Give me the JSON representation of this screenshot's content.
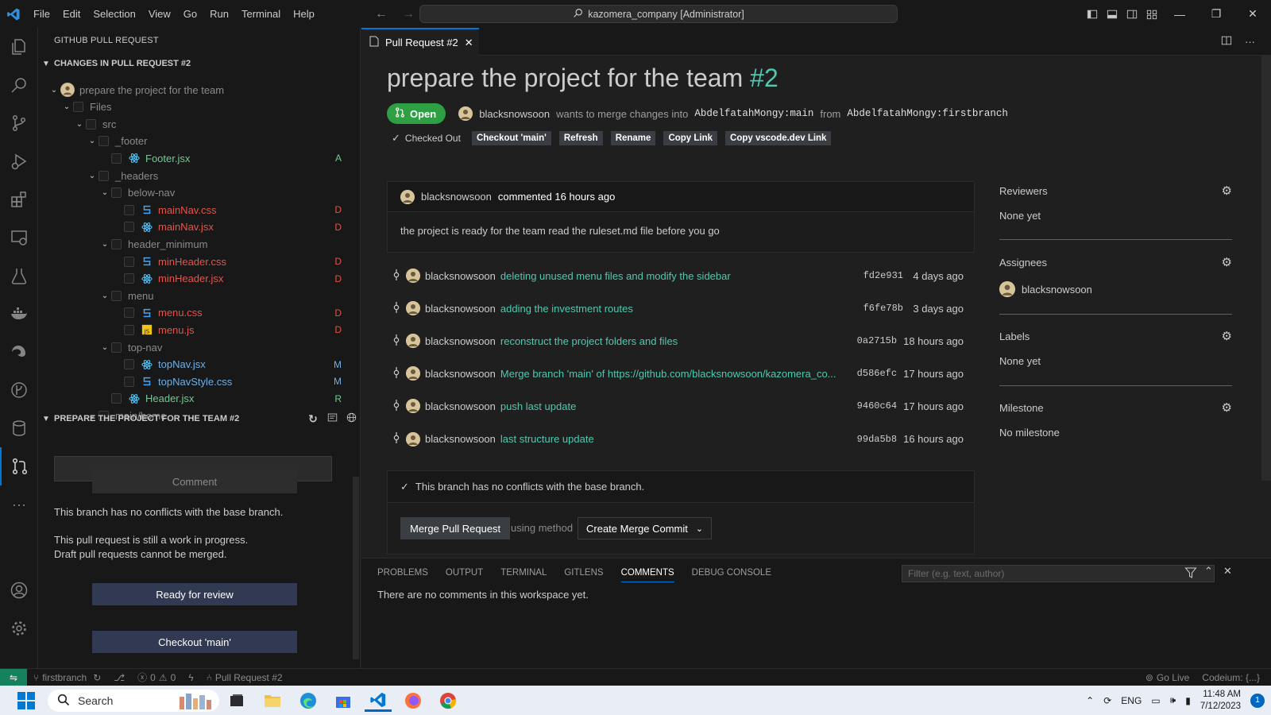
{
  "titlebar": {
    "menu": [
      "File",
      "Edit",
      "Selection",
      "View",
      "Go",
      "Run",
      "Terminal",
      "Help"
    ],
    "command_center": "kazomera_company [Administrator]"
  },
  "sidebar": {
    "title": "GITHUB PULL REQUEST",
    "changes_header": "CHANGES IN PULL REQUEST #2",
    "tree": [
      {
        "label": "prepare the project for the team",
        "type": "pr",
        "depth": 0,
        "decoration": ""
      },
      {
        "label": "Files",
        "type": "folder",
        "depth": 1,
        "decoration": ""
      },
      {
        "label": "src",
        "type": "folder",
        "depth": 2,
        "decoration": ""
      },
      {
        "label": "_footer",
        "type": "folder",
        "depth": 3,
        "decoration": ""
      },
      {
        "label": "Footer.jsx",
        "type": "jsx",
        "depth": 4,
        "decoration": "A",
        "state": "added"
      },
      {
        "label": "_headers",
        "type": "folder",
        "depth": 3,
        "decoration": ""
      },
      {
        "label": "below-nav",
        "type": "folder",
        "depth": 4,
        "decoration": ""
      },
      {
        "label": "mainNav.css",
        "type": "css",
        "depth": 5,
        "decoration": "D",
        "state": "deleted"
      },
      {
        "label": "mainNav.jsx",
        "type": "jsx",
        "depth": 5,
        "decoration": "D",
        "state": "deleted"
      },
      {
        "label": "header_minimum",
        "type": "folder",
        "depth": 4,
        "decoration": ""
      },
      {
        "label": "minHeader.css",
        "type": "css",
        "depth": 5,
        "decoration": "D",
        "state": "deleted"
      },
      {
        "label": "minHeader.jsx",
        "type": "jsx",
        "depth": 5,
        "decoration": "D",
        "state": "deleted"
      },
      {
        "label": "menu",
        "type": "folder",
        "depth": 4,
        "decoration": ""
      },
      {
        "label": "menu.css",
        "type": "css",
        "depth": 5,
        "decoration": "D",
        "state": "deleted"
      },
      {
        "label": "menu.js",
        "type": "js",
        "depth": 5,
        "decoration": "D",
        "state": "deleted"
      },
      {
        "label": "top-nav",
        "type": "folder",
        "depth": 4,
        "decoration": ""
      },
      {
        "label": "topNav.jsx",
        "type": "jsx",
        "depth": 5,
        "decoration": "M",
        "state": "modified"
      },
      {
        "label": "topNavStyle.css",
        "type": "css",
        "depth": 5,
        "decoration": "M",
        "state": "modified"
      },
      {
        "label": "Header.jsx",
        "type": "jsx",
        "depth": 4,
        "decoration": "R",
        "state": "renamed"
      },
      {
        "label": "main/home",
        "type": "folder",
        "depth": 3,
        "decoration": ""
      }
    ],
    "pr_section_header": "PREPARE THE PROJECT FOR THE TEAM #2",
    "comment_button": "Comment",
    "no_conflicts": "This branch has no conflicts with the base branch.",
    "wip_line1": "This pull request is still a work in progress.",
    "wip_line2": "Draft pull requests cannot be merged.",
    "ready_button": "Ready for review",
    "checkout_button": "Checkout 'main'"
  },
  "editor": {
    "tab_label": "Pull Request #2",
    "title": "prepare the project for the team",
    "number": "#2",
    "state": "Open",
    "author": "blacksnowsoon",
    "wants_text": "wants to merge changes into",
    "base_branch": "AbdelfatahMongy:main",
    "from_text": "from",
    "head_branch": "AbdelfatahMongy:firstbranch",
    "checked_out": "Checked Out",
    "actions": [
      "Checkout 'main'",
      "Refresh",
      "Rename",
      "Copy Link",
      "Copy vscode.dev Link"
    ],
    "comment": {
      "author": "blacksnowsoon",
      "meta": "commented 16 hours ago",
      "body": "the project is ready for the team read the ruleset.md file before you go"
    },
    "commits": [
      {
        "author": "blacksnowsoon",
        "message": "deleting unused menu files and modify the sidebar",
        "sha": "fd2e931",
        "when": "4 days ago"
      },
      {
        "author": "blacksnowsoon",
        "message": "adding the investment routes",
        "sha": "f6fe78b",
        "when": "3 days ago"
      },
      {
        "author": "blacksnowsoon",
        "message": "reconstruct the project folders and files",
        "sha": "0a2715b",
        "when": "18 hours ago"
      },
      {
        "author": "blacksnowsoon",
        "message": "Merge branch 'main' of https://github.com/blacksnowsoon/kazomera_co...",
        "sha": "d586efc",
        "when": "17 hours ago"
      },
      {
        "author": "blacksnowsoon",
        "message": "push last update",
        "sha": "9460c64",
        "when": "17 hours ago"
      },
      {
        "author": "blacksnowsoon",
        "message": "last structure update",
        "sha": "99da5b8",
        "when": "16 hours ago"
      }
    ],
    "merge": {
      "no_conflicts": "This branch has no conflicts with the base branch.",
      "button": "Merge Pull Request",
      "using_method": "using method",
      "method": "Create Merge Commit"
    },
    "sidebar": {
      "reviewers_label": "Reviewers",
      "reviewers_value": "None yet",
      "assignees_label": "Assignees",
      "assignee": "blacksnowsoon",
      "labels_label": "Labels",
      "labels_value": "None yet",
      "milestone_label": "Milestone",
      "milestone_value": "No milestone"
    }
  },
  "panel": {
    "tabs": [
      "PROBLEMS",
      "OUTPUT",
      "TERMINAL",
      "GITLENS",
      "COMMENTS",
      "DEBUG CONSOLE"
    ],
    "active_tab": "COMMENTS",
    "filter_placeholder": "Filter (e.g. text, author)",
    "message": "There are no comments in this workspace yet."
  },
  "statusbar": {
    "branch": "firstbranch",
    "errors": "0",
    "warnings": "0",
    "pr": "Pull Request #2",
    "golive": "Go Live",
    "codeium": "Codeium: {...}"
  },
  "taskbar": {
    "search_placeholder": "Search",
    "lang": "ENG",
    "time": "11:48 AM",
    "date": "7/12/2023",
    "notifications": "1"
  },
  "colors": {
    "accent": "#0078d4",
    "open_badge": "#2ea043",
    "link_teal": "#4ec9b0",
    "deleted": "#e5534b",
    "added": "#73c991",
    "modified": "#6fb0e6"
  }
}
